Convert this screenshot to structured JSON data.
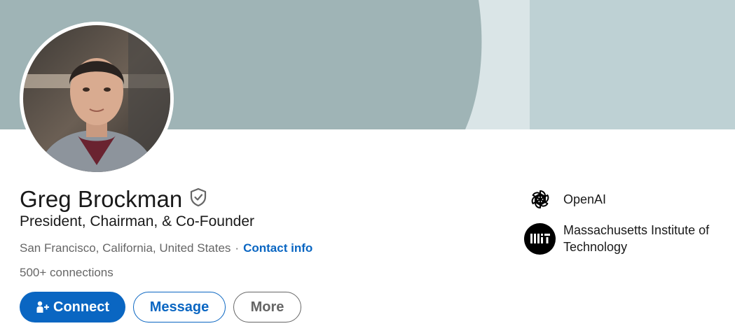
{
  "profile": {
    "name": "Greg Brockman",
    "headline": "President, Chairman, & Co-Founder",
    "location": "San Francisco, California, United States",
    "location_separator": "·",
    "contact_link": "Contact info",
    "connections_count": "500+",
    "connections_label": "connections",
    "verified_icon": "shield-check-icon"
  },
  "actions": {
    "connect_label": "Connect",
    "connect_icon": "add-person-icon",
    "message_label": "Message",
    "more_label": "More"
  },
  "experience": [
    {
      "name": "OpenAI",
      "logo": "openai-logo"
    },
    {
      "name": "Massachusetts Institute of Technology",
      "logo": "mit-logo"
    }
  ],
  "colors": {
    "accent": "#0a66c2",
    "banner_dark": "#9fb4b6",
    "banner_light": "#bed1d4",
    "banner_pale": "#dae5e7",
    "secondary_text": "#666666"
  }
}
